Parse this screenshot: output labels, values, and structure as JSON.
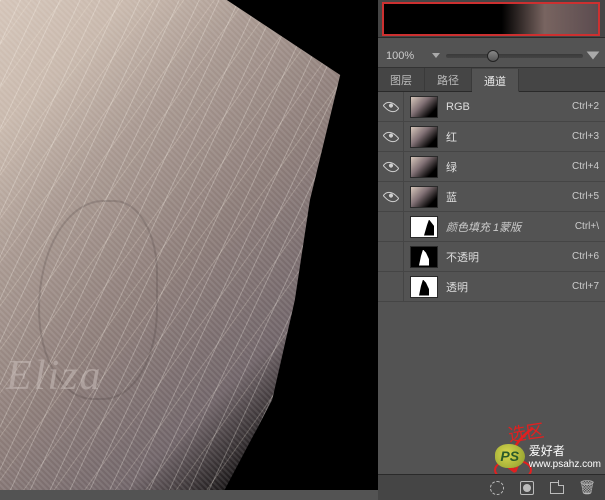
{
  "canvas": {
    "watermark": "f Eliza"
  },
  "zoom": {
    "value": "100%"
  },
  "tabs": {
    "layers": "图层",
    "paths": "路径",
    "channels": "通道"
  },
  "channels": [
    {
      "name": "RGB",
      "shortcut": "Ctrl+2",
      "visible": true,
      "thumb": "img"
    },
    {
      "name": "红",
      "shortcut": "Ctrl+3",
      "visible": true,
      "thumb": "img"
    },
    {
      "name": "绿",
      "shortcut": "Ctrl+4",
      "visible": true,
      "thumb": "img"
    },
    {
      "name": "蓝",
      "shortcut": "Ctrl+5",
      "visible": true,
      "thumb": "img"
    },
    {
      "name": "颜色填充 1蒙版",
      "shortcut": "Ctrl+\\",
      "visible": false,
      "thumb": "maskfill",
      "italic": true
    },
    {
      "name": "不透明",
      "shortcut": "Ctrl+6",
      "visible": false,
      "thumb": "opq"
    },
    {
      "name": "透明",
      "shortcut": "Ctrl+7",
      "visible": false,
      "thumb": "trans"
    }
  ],
  "annotation": {
    "text": "选区"
  },
  "watermark_site": {
    "badge": "PS",
    "domain": "爱好者",
    "site": "www.psahz.com"
  }
}
